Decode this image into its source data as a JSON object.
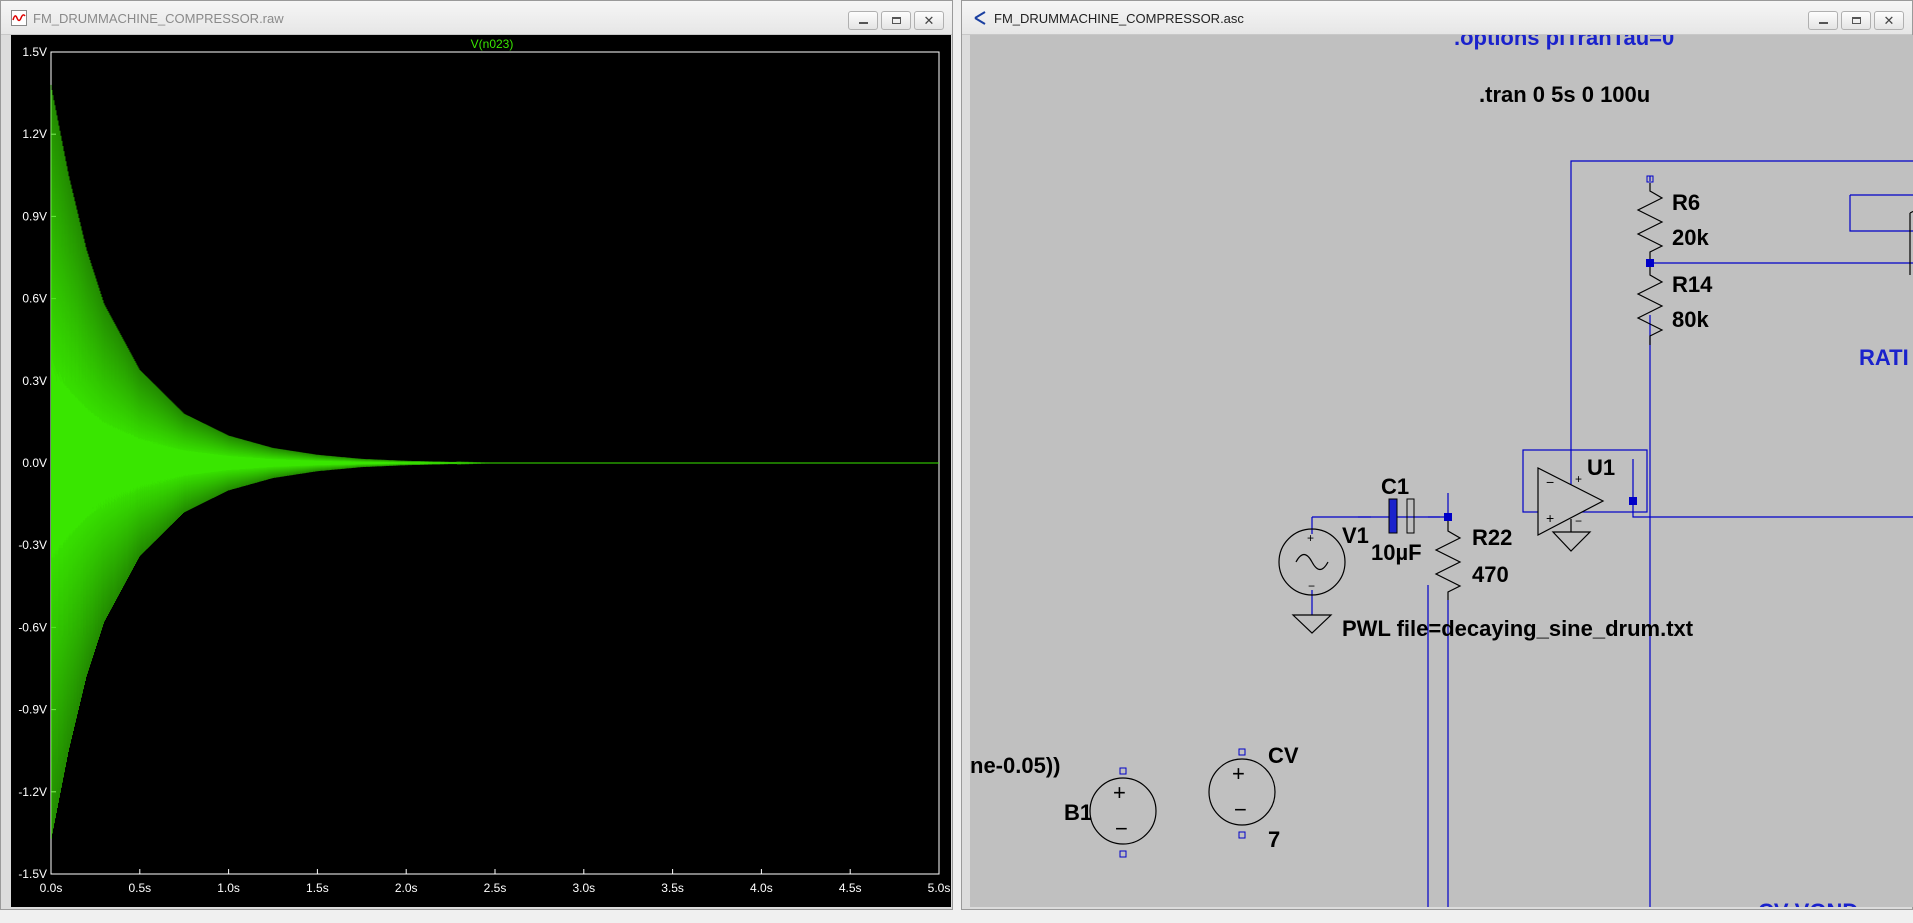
{
  "left_window": {
    "title": "FM_DRUMMACHINE_COMPRESSOR.raw",
    "icon": "waveform-icon"
  },
  "right_window": {
    "title": "FM_DRUMMACHINE_COMPRESSOR.asc",
    "icon": "schematic-icon"
  },
  "window_controls": {
    "minimize": "minimize-icon",
    "restore": "restore-icon",
    "close": "✕"
  },
  "colors": {
    "trace": "#39e600",
    "plot_bg": "#000000",
    "schematic_bg": "#c0c0c0",
    "wire": "#0000c8",
    "directive": "#1a22cc",
    "label": "#000000"
  },
  "chart_data": {
    "type": "line",
    "title": "V(n023)",
    "xlabel": "",
    "ylabel": "",
    "x_ticks": [
      "0.0s",
      "0.5s",
      "1.0s",
      "1.5s",
      "2.0s",
      "2.5s",
      "3.0s",
      "3.5s",
      "4.0s",
      "4.5s",
      "5.0s"
    ],
    "y_ticks": [
      "1.5V",
      "1.2V",
      "0.9V",
      "0.6V",
      "0.3V",
      "0.0V",
      "-0.3V",
      "-0.6V",
      "-0.9V",
      "-1.2V",
      "-1.5V"
    ],
    "xlim": [
      0,
      5
    ],
    "ylim": [
      -1.5,
      1.5
    ],
    "grid": false,
    "series": [
      {
        "name": "V(n023)",
        "envelope": "decaying sine",
        "x": [
          0.0,
          0.1,
          0.2,
          0.3,
          0.5,
          0.75,
          1.0,
          1.25,
          1.5,
          1.75,
          2.0,
          2.5,
          5.0
        ],
        "y_peak": [
          1.38,
          1.05,
          0.78,
          0.58,
          0.34,
          0.18,
          0.1,
          0.055,
          0.03,
          0.015,
          0.008,
          0.0,
          0.0
        ]
      }
    ]
  },
  "schematic": {
    "directives": [
      ".options plTranTau=0",
      ".tran 0 5s 0 100u"
    ],
    "components": [
      {
        "ref": "R6",
        "value": "20k"
      },
      {
        "ref": "R14",
        "value": "80k"
      },
      {
        "ref": "U1",
        "value": ""
      },
      {
        "ref": "C1",
        "value": "10µF"
      },
      {
        "ref": "V1",
        "value": "PWL file=decaying_sine_drum.txt"
      },
      {
        "ref": "R22",
        "value": "470"
      },
      {
        "ref": "B1",
        "value": ""
      },
      {
        "ref": "CV",
        "value": "7"
      }
    ],
    "labels": {
      "ratio": "RATI",
      "b1_expr": "ne-0.05))",
      "bottom_net": "CV VOND"
    }
  }
}
